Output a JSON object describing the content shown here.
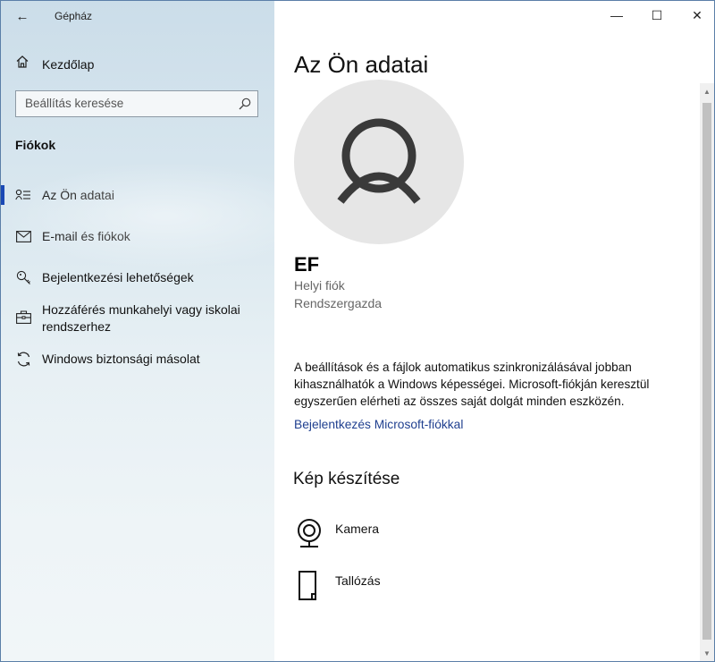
{
  "app": {
    "title": "Gépház",
    "back_glyph": "←"
  },
  "window_controls": {
    "minimize": "—",
    "maximize": "☐",
    "close": "✕"
  },
  "sidebar": {
    "home_label": "Kezdőlap",
    "search_placeholder": "Beállítás keresése",
    "section_title": "Fiókok",
    "items": [
      {
        "label": "Az Ön adatai",
        "icon": "person-card-icon",
        "active": true
      },
      {
        "label": "E-mail és fiókok",
        "icon": "mail-icon",
        "active": false
      },
      {
        "label": "Bejelentkezési lehetőségek",
        "icon": "key-icon",
        "active": false
      },
      {
        "label": "Hozzáférés munkahelyi vagy iskolai rendszerhez",
        "icon": "briefcase-icon",
        "active": false
      },
      {
        "label": "Windows biztonsági másolat",
        "icon": "sync-icon",
        "active": false
      }
    ]
  },
  "main": {
    "title": "Az Ön adatai",
    "user": {
      "name": "EF",
      "account_type": "Helyi fiók",
      "role": "Rendszergazda"
    },
    "description": "A beállítások és a fájlok automatikus szinkronizálásával jobban kihasználhatók a Windows képességei. Microsoft-fiókján keresztül egyszerűen elérheti az összes saját dolgát minden eszközén.",
    "signin_link": "Bejelentkezés Microsoft-fiókkal",
    "photo_section_title": "Kép készítése",
    "photo_options": [
      {
        "label": "Kamera",
        "icon": "camera-icon"
      },
      {
        "label": "Tallózás",
        "icon": "browse-file-icon"
      }
    ]
  },
  "colors": {
    "accent": "#1a49b5",
    "link": "#1f3f8f"
  }
}
